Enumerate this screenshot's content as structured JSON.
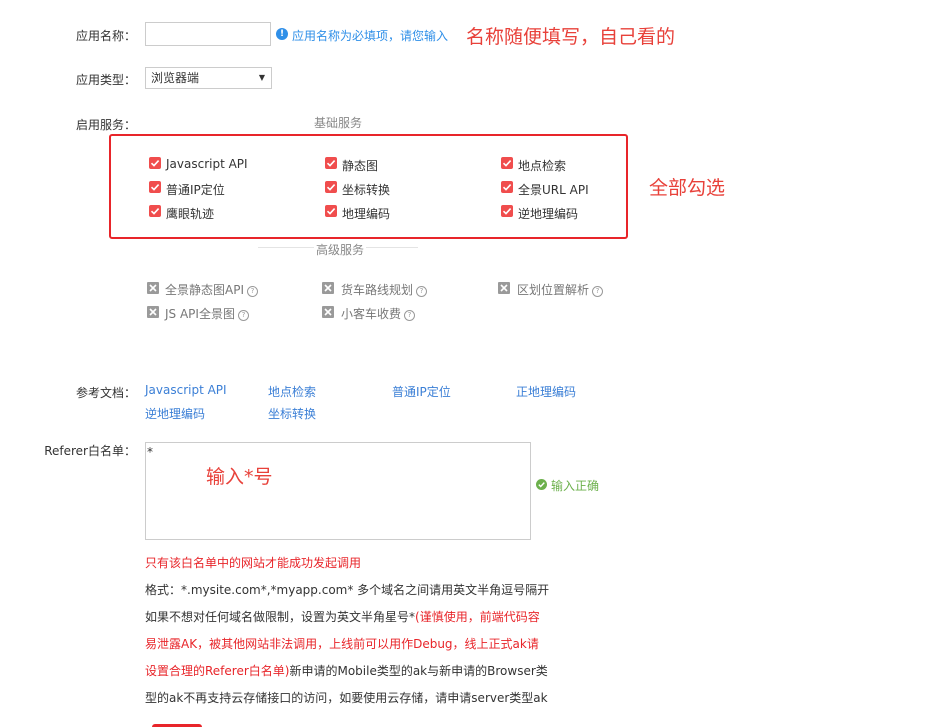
{
  "form": {
    "app_name_label": "应用名称：",
    "app_name_value": "",
    "app_name_warning": "应用名称为必填项，请您输入",
    "app_type_label": "应用类型：",
    "app_type_value": "浏览器端",
    "services_label": "启用服务：",
    "basic_services_title": "基础服务",
    "advanced_services_title": "高级服务",
    "docs_label": "参考文档：",
    "referer_label": "Referer白名单：",
    "referer_value": "*",
    "referer_ok": "输入正确"
  },
  "annotations": {
    "name_hint": "名称随便填写，自己看的",
    "select_all_hint": "全部勾选",
    "asterisk_hint": "输入*号"
  },
  "basic_services": [
    {
      "label": "Javascript API",
      "checked": true
    },
    {
      "label": "静态图",
      "checked": true
    },
    {
      "label": "地点检索",
      "checked": true
    },
    {
      "label": "普通IP定位",
      "checked": true
    },
    {
      "label": "坐标转换",
      "checked": true
    },
    {
      "label": "全景URL API",
      "checked": true
    },
    {
      "label": "鹰眼轨迹",
      "checked": true
    },
    {
      "label": "地理编码",
      "checked": true
    },
    {
      "label": "逆地理编码",
      "checked": true
    }
  ],
  "advanced_services": [
    {
      "label": "全景静态图API"
    },
    {
      "label": "货车路线规划"
    },
    {
      "label": "区划位置解析"
    },
    {
      "label": "JS API全景图"
    },
    {
      "label": "小客车收费"
    }
  ],
  "docs": [
    {
      "label": "Javascript API"
    },
    {
      "label": "地点检索"
    },
    {
      "label": "普通IP定位"
    },
    {
      "label": "正地理编码"
    },
    {
      "label": "逆地理编码"
    },
    {
      "label": "坐标转换"
    }
  ],
  "notes": {
    "line1": "只有该白名单中的网站才能成功发起调用",
    "line2": "格式：*.mysite.com*,*myapp.com* 多个域名之间请用英文半角逗号隔开",
    "line3_a": "如果不想对任何域名做限制，设置为英文半角星号*",
    "line3_b": "(谨慎使用，前端代码容",
    "line4": "易泄露AK，被其他网站非法调用，上线前可以用作Debug，线上正式ak请",
    "line5_a": "设置合理的Referer白名单)",
    "line5_b": "新申请的Mobile类型的ak与新申请的Browser类",
    "line6": "型的ak不再支持云存储接口的访问，如要使用云存储，请申请server类型ak"
  },
  "colors": {
    "accent_red": "#e8252a",
    "checkbox_red": "#f04d4d",
    "link_blue": "#3b7fd6",
    "ok_green": "#6cb04c"
  }
}
